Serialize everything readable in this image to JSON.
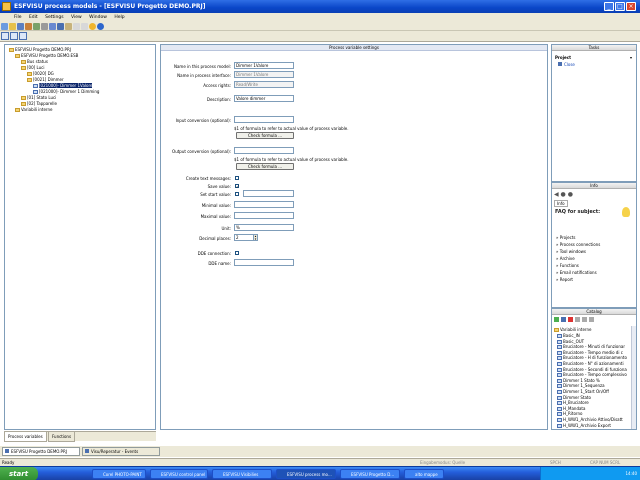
{
  "window": {
    "title": "ESFVISU process models - [ESFVISU Progetto DEMO.PRJ]"
  },
  "menu": {
    "items": [
      "File",
      "Edit",
      "Settings",
      "View",
      "Window",
      "Help"
    ]
  },
  "tree": {
    "items": [
      {
        "label": "ESFVISU Progetto DEMO.PRJ",
        "indent": 0,
        "icon": "folder",
        "selected": false
      },
      {
        "label": "ESFVISU Progetto DEMO.ESB",
        "indent": 1,
        "icon": "folder",
        "selected": false
      },
      {
        "label": "Bus status",
        "indent": 2,
        "icon": "folder",
        "selected": false
      },
      {
        "label": "[00] Luci",
        "indent": 2,
        "icon": "folder",
        "selected": false
      },
      {
        "label": "[0020] DG",
        "indent": 3,
        "icon": "folder",
        "selected": false
      },
      {
        "label": "[0021] Dimmer",
        "indent": 3,
        "icon": "folder",
        "selected": false
      },
      {
        "label": "[021000]- Dimmer 1Valore",
        "indent": 4,
        "icon": "monitor",
        "selected": true
      },
      {
        "label": "[021000]- Dimmer 1 Dimming",
        "indent": 4,
        "icon": "monitor",
        "selected": false
      },
      {
        "label": "[01] Stato Luci",
        "indent": 2,
        "icon": "folder",
        "selected": false
      },
      {
        "label": "[02] Tapparelle",
        "indent": 2,
        "icon": "folder",
        "selected": false
      },
      {
        "label": "Variabili interne",
        "indent": 1,
        "icon": "folder",
        "selected": false
      }
    ]
  },
  "left_tabs": {
    "process_variables": "Process variables",
    "functions": "Functions"
  },
  "settings": {
    "header": "Process variable settings",
    "name_model_label": "Name in this process model:",
    "name_model_value": "Dimmer 1Valore",
    "name_interface_label": "Name in process interface:",
    "name_interface_value": "Dimmer 1Valore",
    "access_label": "Access rights:",
    "access_value": "Read/Write",
    "description_label": "Description:",
    "description_value": "Valore dimmer",
    "input_conv_label": "Input conversion (optional):",
    "input_conv_value": "",
    "input_note": "$1 of formula to refer to actual value of process variable.",
    "check_formula_1": "Check formula ...",
    "output_conv_label": "Output conversion (optional):",
    "output_conv_value": "",
    "output_note": "$1 of formula to refer to actual value of process variable.",
    "check_formula_2": "Check formula ...",
    "create_text_label": "Create text messages:",
    "save_value_label": "Save value:",
    "set_start_label": "Set start value:",
    "minimal_label": "Minimal value:",
    "minimal_value": "",
    "maximal_label": "Maximal value:",
    "maximal_value": "",
    "unit_label": "Unit:",
    "unit_value": "%",
    "decimal_label": "Decimal places:",
    "decimal_value": "2",
    "dde_conn_label": "DDE connection:",
    "dde_name_label": "DDE name:",
    "dde_name_value": ""
  },
  "tasks": {
    "header": "Tasks",
    "project_label": "Project",
    "close_label": "Close"
  },
  "info": {
    "header": "Info",
    "tab": "Info",
    "faq": "FAQ for subject:",
    "links": [
      "Projects",
      "Process connections",
      "Tool windows",
      "Archive",
      "Functions",
      "Email notifications",
      "Report"
    ]
  },
  "catalog": {
    "header": "Catalog",
    "root": "Variabili interne",
    "items": [
      "Basic_IN",
      "Basic_OUT",
      "Bruciatore - Minuti di funzionar",
      "Bruciatore - Tempo medio di c",
      "Bruciatore - H di funzionamento",
      "Bruciatore - N° di azionamenti",
      "Bruciatore - Secondi di funziona",
      "Bruciatore - Tempo complessivo",
      "Dimmer 1 Stato %",
      "Dimmer 1_Sequenza",
      "Dimmer 1_Start On/Off",
      "Dimmer Stato",
      "H_Bruciatore",
      "H_Mandata",
      "H_Ritorno",
      "H_WW1_Archivio Attivo/Disatt",
      "H_WW1_Archivio Export"
    ]
  },
  "doc_tabs": [
    "ESFVISU Progetto DEMO.PRJ",
    "Visu/Reperatur - Events"
  ],
  "status": {
    "left": "Ready",
    "mid": "Eingabemodus: Quelle",
    "right1": "SPCH",
    "right2": "CAP  NUM  SCRL"
  },
  "taskbar": {
    "start": "start",
    "tasks": [
      "Corel PHOTO-PAINT",
      "ESFVISU control panel",
      "ESFVISU Visibilies",
      "ESFVISU process mo...",
      "ESFVISU Progetto D...",
      "alto mappe"
    ],
    "clock": "14:40"
  }
}
